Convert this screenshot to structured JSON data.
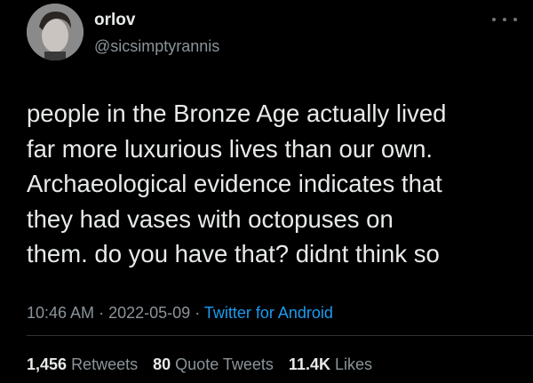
{
  "author": {
    "name": "orlov",
    "handle": "@sicsimptyrannis"
  },
  "tweet": {
    "lines": [
      "people in the Bronze Age actually lived",
      "far more luxurious lives than our own.",
      "Archaeological evidence indicates that",
      "they had vases with octopuses on",
      "them. do you have that? didnt think so"
    ],
    "time": "10:46 AM",
    "separator": "·",
    "date": "2022-05-09",
    "source": "Twitter for Android"
  },
  "stats": {
    "retweets_count": "1,456",
    "retweets_label": "Retweets",
    "quotes_count": "80",
    "quotes_label": "Quote Tweets",
    "likes_count": "11.4K",
    "likes_label": "Likes"
  },
  "icons": {
    "more": "more-horizontal-icon"
  },
  "colors": {
    "background": "#000000",
    "text": "#e7e9ea",
    "secondary": "#8b949a",
    "link": "#1d9bf0",
    "divider": "#2f3336"
  }
}
